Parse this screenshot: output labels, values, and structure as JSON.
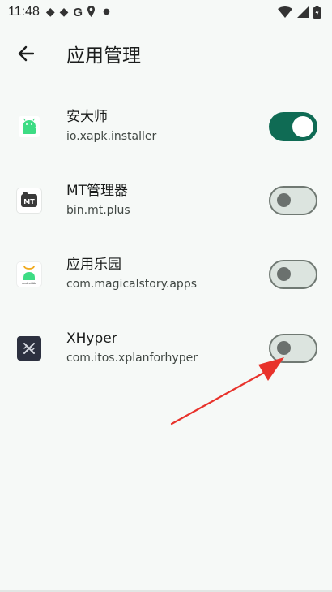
{
  "status_bar": {
    "time": "11:48",
    "left_icons": [
      "diamond-icon",
      "diamond-icon",
      "google-icon",
      "location-icon",
      "dot-icon"
    ],
    "right_icons": [
      "wifi-icon",
      "signal-icon",
      "battery-icon"
    ]
  },
  "header": {
    "back_icon": "arrow-back-icon",
    "title": "应用管理"
  },
  "apps": [
    {
      "name": "安大师",
      "package": "io.xapk.installer",
      "icon": "android-green-icon",
      "enabled": true
    },
    {
      "name": "MT管理器",
      "package": "bin.mt.plus",
      "icon": "mt-manager-icon",
      "enabled": false
    },
    {
      "name": "应用乐园",
      "package": "com.magicalstory.apps",
      "icon": "app-park-icon",
      "enabled": false
    },
    {
      "name": "XHyper",
      "package": "com.itos.xplanforhyper",
      "icon": "xhyper-icon",
      "enabled": false
    }
  ],
  "colors": {
    "background": "#f6f9f7",
    "toggle_on": "#0f6b54",
    "toggle_off_track": "#dce4df",
    "annotation_arrow": "#e8322b"
  }
}
